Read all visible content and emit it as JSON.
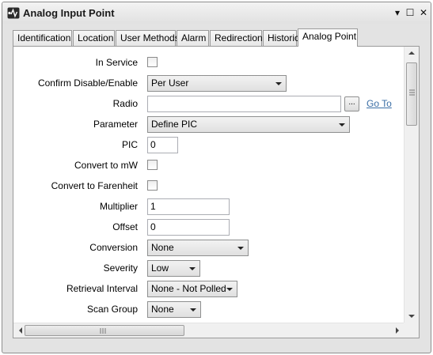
{
  "window": {
    "title": "Analog Input Point"
  },
  "window_controls": {
    "dropdown": "▾",
    "maximize": "☐",
    "close": "✕"
  },
  "tabs": [
    {
      "label": "Identification",
      "active": false
    },
    {
      "label": "Location",
      "active": false
    },
    {
      "label": "User Methods",
      "active": false
    },
    {
      "label": "Alarm",
      "active": false
    },
    {
      "label": "Redirection",
      "active": false
    },
    {
      "label": "Historic",
      "active": false
    },
    {
      "label": "Analog Point",
      "active": true
    }
  ],
  "fields": {
    "in_service": {
      "label": "In Service",
      "checked": false
    },
    "confirm_disable_enable": {
      "label": "Confirm Disable/Enable",
      "value": "Per User"
    },
    "radio": {
      "label": "Radio",
      "value": "",
      "browse_label": "...",
      "goto_label": "Go To"
    },
    "parameter": {
      "label": "Parameter",
      "value": "Define PIC"
    },
    "pic": {
      "label": "PIC",
      "value": "0"
    },
    "convert_to_mw": {
      "label": "Convert to mW",
      "checked": false
    },
    "convert_to_farenheit": {
      "label": "Convert to Farenheit",
      "checked": false
    },
    "multiplier": {
      "label": "Multiplier",
      "value": "1"
    },
    "offset": {
      "label": "Offset",
      "value": "0"
    },
    "conversion": {
      "label": "Conversion",
      "value": "None"
    },
    "severity": {
      "label": "Severity",
      "value": "Low"
    },
    "retrieval_interval": {
      "label": "Retrieval Interval",
      "value": "None - Not Polled"
    },
    "scan_group": {
      "label": "Scan Group",
      "value": "None"
    }
  },
  "colors": {
    "link": "#3a6ea5",
    "window_bg": "#e3e3e3",
    "panel_bg": "#ffffff"
  },
  "icons": [
    "app-icon",
    "window-menu-icon",
    "maximize-icon",
    "close-icon",
    "dropdown-arrow-icon",
    "scroll-up-icon",
    "scroll-down-icon",
    "scroll-left-icon",
    "scroll-right-icon",
    "scroll-grip-icon"
  ]
}
